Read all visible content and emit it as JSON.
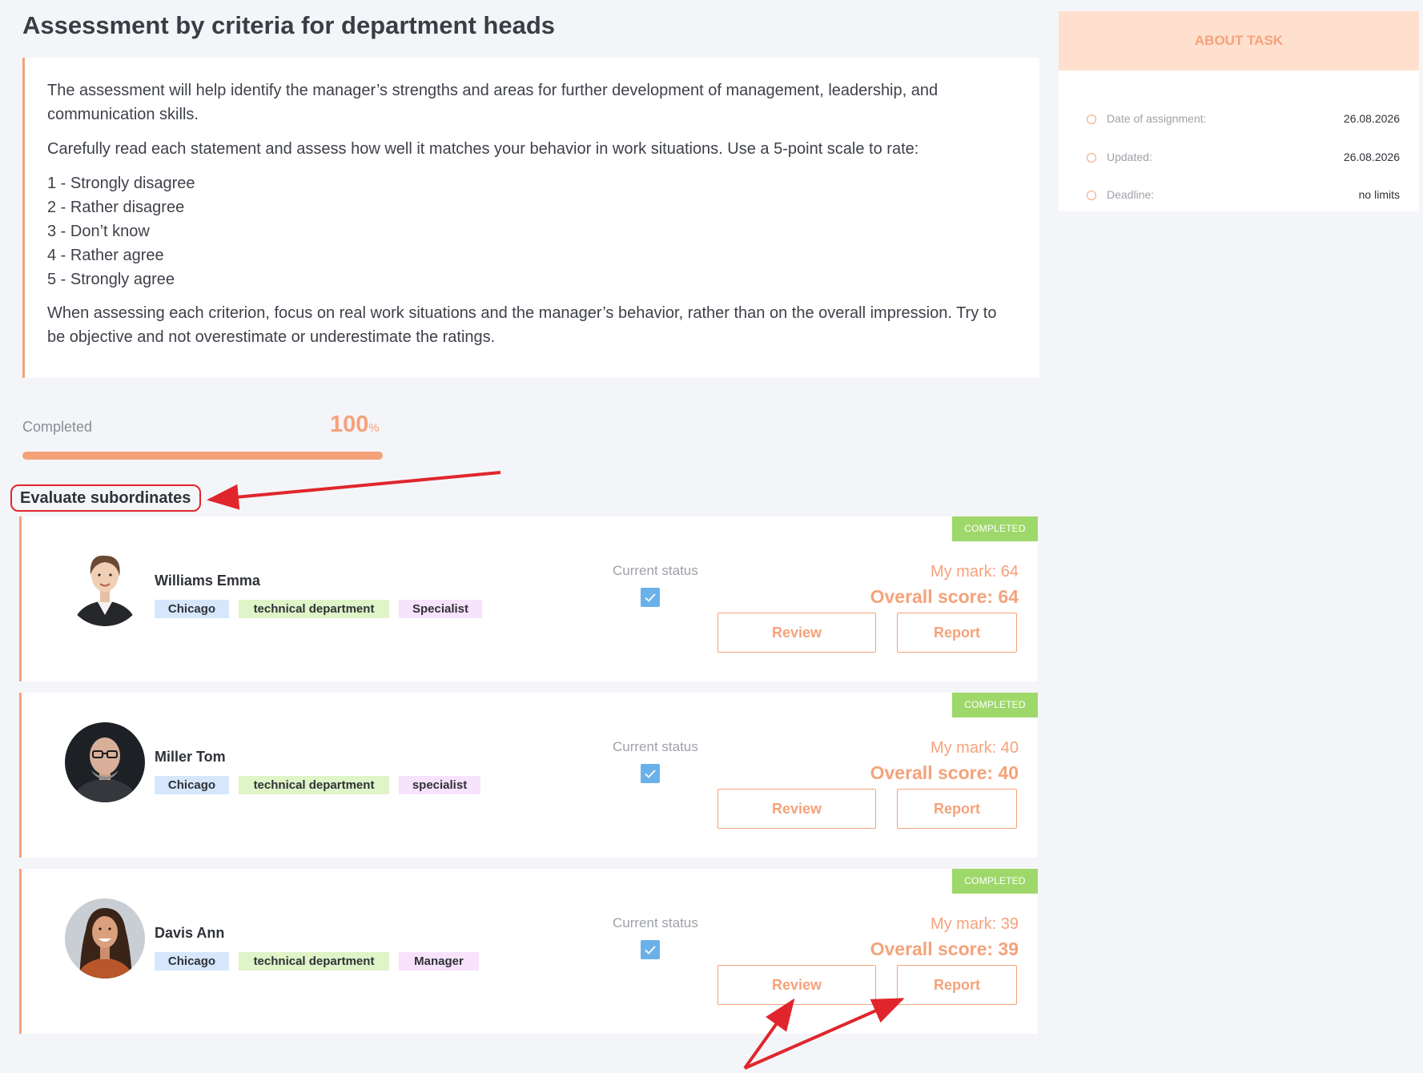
{
  "page": {
    "title": "Assessment by criteria for department heads"
  },
  "intro": {
    "para1": "The assessment will help identify the manager’s strengths and areas for further development of management, leadership, and communication skills.",
    "para2": "Carefully read each statement and assess how well it matches your behavior in work situations. Use a 5-point scale to rate:",
    "scale": [
      "1 - Strongly disagree",
      "2 - Rather disagree",
      "3 - Don’t know",
      "4 - Rather agree",
      "5 - Strongly agree"
    ],
    "para3": "When assessing each criterion, focus on real work situations and the manager’s behavior, rather than on the overall impression. Try to be objective and not overestimate or underestimate the ratings."
  },
  "progress": {
    "label": "Completed",
    "value": "100",
    "unit": "%",
    "fraction": 1.0
  },
  "section": {
    "heading": "Evaluate subordinates"
  },
  "subordinates": [
    {
      "badge": "COMPLETED",
      "name": "Williams Emma",
      "city": "Chicago",
      "department": "technical department",
      "role": "Specialist",
      "status_label": "Current status",
      "my_mark": "My mark: 64",
      "overall_score": "Overall score: 64",
      "review_label": "Review",
      "report_label": "Report"
    },
    {
      "badge": "COMPLETED",
      "name": "Miller Tom",
      "city": "Chicago",
      "department": "technical department",
      "role": "specialist",
      "status_label": "Current status",
      "my_mark": "My mark: 40",
      "overall_score": "Overall score: 40",
      "review_label": "Review",
      "report_label": "Report"
    },
    {
      "badge": "COMPLETED",
      "name": "Davis Ann",
      "city": "Chicago",
      "department": "technical department",
      "role": "Manager",
      "status_label": "Current status",
      "my_mark": "My mark: 39",
      "overall_score": "Overall score: 39",
      "review_label": "Review",
      "report_label": "Report"
    }
  ],
  "about": {
    "title": "ABOUT TASK",
    "rows": [
      {
        "key": "Date of assignment:",
        "value": "26.08.2026"
      },
      {
        "key": "Updated:",
        "value": "26.08.2026"
      },
      {
        "key": "Deadline:",
        "value": "no limits"
      }
    ]
  },
  "colors": {
    "accent": "#f5a27a",
    "badge": "#9fd86a",
    "annotation": "#e0262c"
  }
}
